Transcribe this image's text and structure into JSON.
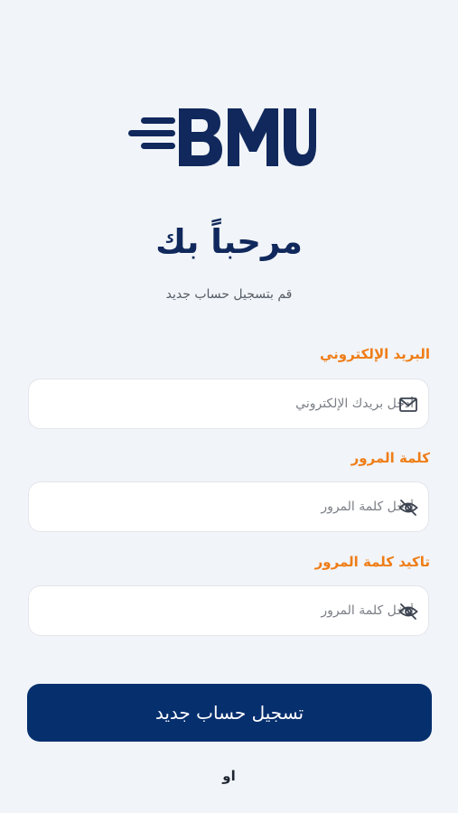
{
  "brand": {
    "logo_text": "BMU",
    "color": "#10285c"
  },
  "header": {
    "title": "مرحباً بك",
    "subtitle": "قم بتسجيل حساب جديد"
  },
  "form": {
    "email": {
      "label": "البريد الإلكتروني",
      "placeholder": "أدخل بريدك الإلكتروني",
      "value": "",
      "icon": "mail-icon"
    },
    "password": {
      "label": "كلمة المرور",
      "placeholder": "أدخل كلمة المرور",
      "value": "",
      "icon": "eye-off-icon"
    },
    "confirm_password": {
      "label": "تاكيد كلمة المرور",
      "placeholder": "أدخل كلمة المرور",
      "value": "",
      "icon": "eye-off-icon"
    }
  },
  "actions": {
    "register_label": "تسجيل حساب جديد",
    "or_label": "او"
  },
  "colors": {
    "accent": "#ef7d17",
    "primary": "#062f6e",
    "background": "#f1f4f8"
  }
}
